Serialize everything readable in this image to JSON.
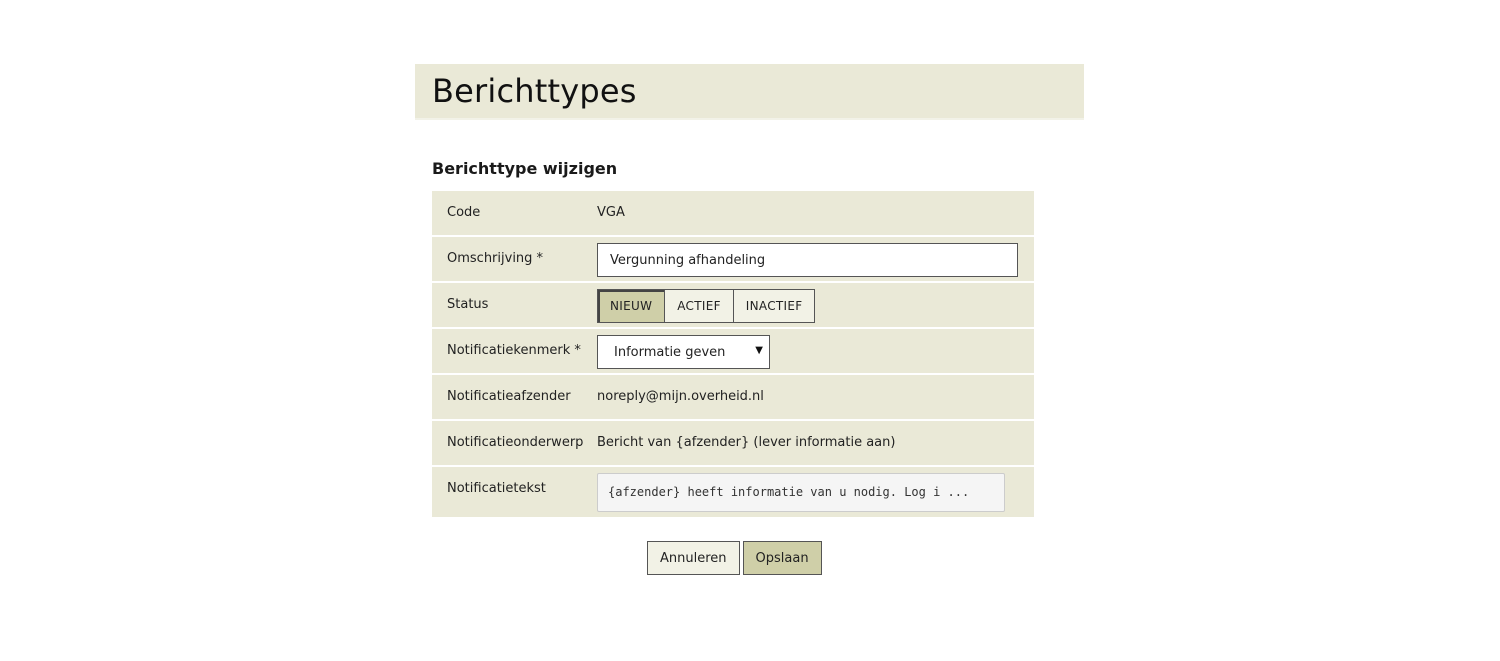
{
  "header": {
    "title": "Berichttypes"
  },
  "form": {
    "section_title": "Berichttype wijzigen",
    "code": {
      "label": "Code",
      "value": "VGA"
    },
    "omschrijving": {
      "label": "Omschrijving *",
      "value": "Vergunning afhandeling"
    },
    "status": {
      "label": "Status",
      "options": [
        "NIEUW",
        "ACTIEF",
        "INACTIEF"
      ],
      "selected": "NIEUW"
    },
    "notificatiekenmerk": {
      "label": "Notificatiekenmerk *",
      "selected": "Informatie geven"
    },
    "notificatieafzender": {
      "label": "Notificatieafzender",
      "value": "noreply@mijn.overheid.nl"
    },
    "notificatieonderwerp": {
      "label": "Notificatieonderwerp",
      "value": "Bericht van {afzender} (lever informatie aan)"
    },
    "notificatietekst": {
      "label": "Notificatietekst",
      "value": "{afzender} heeft informatie van u nodig. Log i ..."
    }
  },
  "actions": {
    "cancel_label": "Annuleren",
    "save_label": "Opslaan"
  },
  "colors": {
    "panel_background": "#eae9d7",
    "active_button": "#cfcfa8",
    "inactive_button": "#f2f2e6"
  },
  "icons": {
    "select_arrow": "caret-down-icon"
  }
}
